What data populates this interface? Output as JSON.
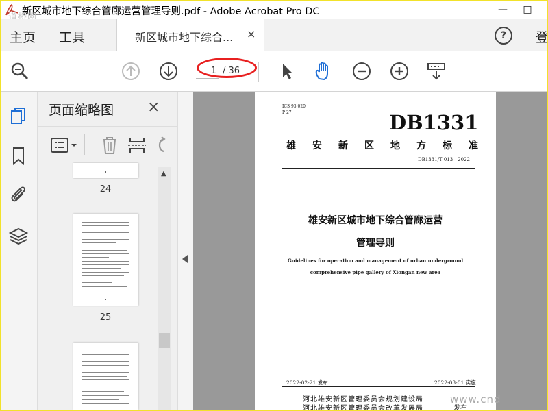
{
  "window": {
    "title": "新区城市地下综合管廊运营管理导则.pdf - Adobe Acrobat Pro DC",
    "minimize": "—",
    "maximize": "□"
  },
  "watermark": {
    "top_left": "道桥网",
    "bottom_right": "www.cnd"
  },
  "menu": {
    "home": "主页",
    "tools": "工具",
    "login": "登"
  },
  "doc_tab": {
    "label": "新区城市地下综合...",
    "close": "×"
  },
  "toolbar": {
    "page_current": "1",
    "page_total": "/ 36"
  },
  "thumb_panel": {
    "title": "页面缩略图",
    "close": "×",
    "pages": [
      {
        "label": "24"
      },
      {
        "label": "25"
      }
    ]
  },
  "page": {
    "ics": "ICS 93.020",
    "p_code": "P 27",
    "db": "DB1331",
    "local_std": "雄安新区地方标准",
    "std_code": "DB1331/T 013—2022",
    "title_line1": "雄安新区城市地下综合管廊运营",
    "title_line2": "管理导则",
    "en_line1": "Guidelines for operation and management of urban underground",
    "en_line2": "comprehensive pipe gallery of Xiongan new area",
    "issue_date": "2022-02-21 发布",
    "impl_date": "2022-03-01 实施",
    "org1": "河北雄安新区管理委员会规划建设局",
    "org2": "河北雄安新区管理委员会改革发展局",
    "publish": "发布"
  },
  "colors": {
    "accent": "#1f6fd6",
    "annotation": "#e82020",
    "frame": "#f2e22a"
  }
}
